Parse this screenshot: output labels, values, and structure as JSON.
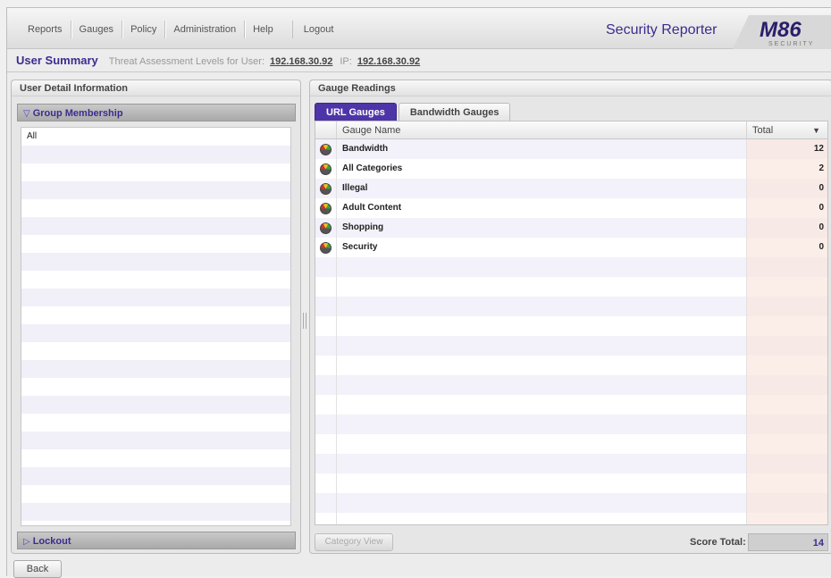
{
  "nav": {
    "items": [
      "Reports",
      "Gauges",
      "Policy",
      "Administration"
    ],
    "help": "Help",
    "logout": "Logout"
  },
  "brand": {
    "title": "Security Reporter",
    "logo_text": "M86",
    "logo_sub": "SECURITY",
    "accent": "#3d2b8e"
  },
  "summary": {
    "title": "User Summary",
    "threat_label": "Threat Assessment Levels for User:",
    "user": "192.168.30.92",
    "ip_label": "IP:",
    "ip": "192.168.30.92"
  },
  "left_panel": {
    "title": "User Detail Information",
    "group_header": "Group Membership",
    "groups": [
      "All"
    ],
    "lockout_header": "Lockout"
  },
  "right_panel": {
    "title": "Gauge Readings",
    "tabs": [
      {
        "label": "URL Gauges",
        "active": true
      },
      {
        "label": "Bandwidth Gauges",
        "active": false
      }
    ],
    "columns": {
      "name": "Gauge Name",
      "total": "Total"
    },
    "rows": [
      {
        "name": "Bandwidth",
        "total": "12"
      },
      {
        "name": "All Categories",
        "total": "2"
      },
      {
        "name": "Illegal",
        "total": "0"
      },
      {
        "name": "Adult Content",
        "total": "0"
      },
      {
        "name": "Shopping",
        "total": "0"
      },
      {
        "name": "Security",
        "total": "0"
      }
    ],
    "category_view": "Category View",
    "score_label": "Score Total:",
    "score_total": "14"
  },
  "back_label": "Back"
}
